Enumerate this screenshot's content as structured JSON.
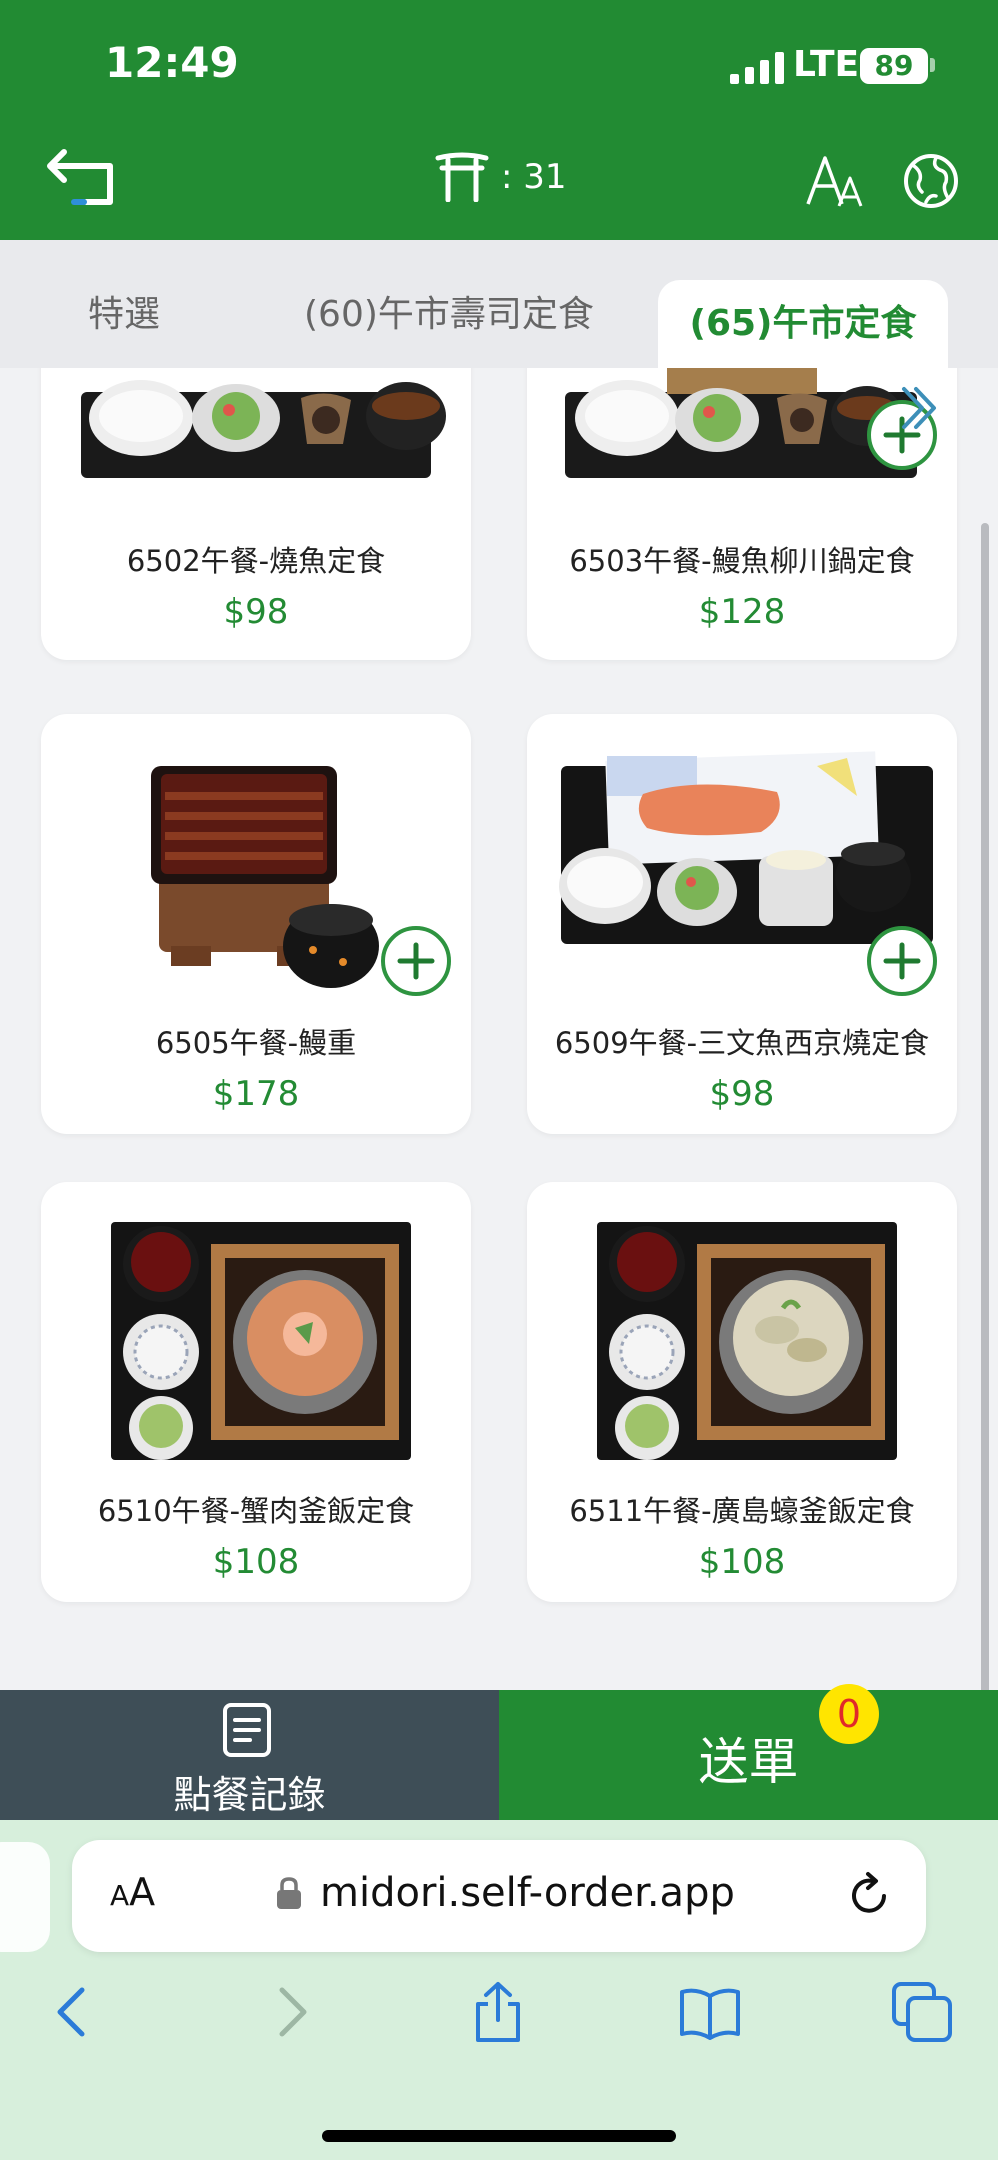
{
  "status_bar": {
    "time": "12:49",
    "network": "LTE",
    "battery": "89"
  },
  "header": {
    "table_number": ": 31"
  },
  "tabs": [
    {
      "label": "特選"
    },
    {
      "label": "(60)午市壽司定食"
    },
    {
      "label": "(65)午市定食"
    }
  ],
  "menu_items": [
    {
      "name": "6502午餐-燒魚定食",
      "price": "$98"
    },
    {
      "name": "6503午餐-鰻魚柳川鍋定食",
      "price": "$128"
    },
    {
      "name": "6505午餐-鰻重",
      "price": "$178"
    },
    {
      "name": "6509午餐-三文魚西京燒定食",
      "price": "$98"
    },
    {
      "name": "6510午餐-蟹肉釜飯定食",
      "price": "$108"
    },
    {
      "name": "6511午餐-廣島蠔釜飯定食",
      "price": "$108"
    }
  ],
  "bottom_bar": {
    "history_label": "點餐記錄",
    "submit_label": "送單",
    "cart_count": "0"
  },
  "browser": {
    "aa_large": "A",
    "aa_small": "A",
    "url": "midori.self-order.app"
  },
  "colors": {
    "brand_green": "#228b33",
    "price_green": "#238b34",
    "history_bg": "#3e4e57",
    "badge_yellow": "#ffe500"
  }
}
